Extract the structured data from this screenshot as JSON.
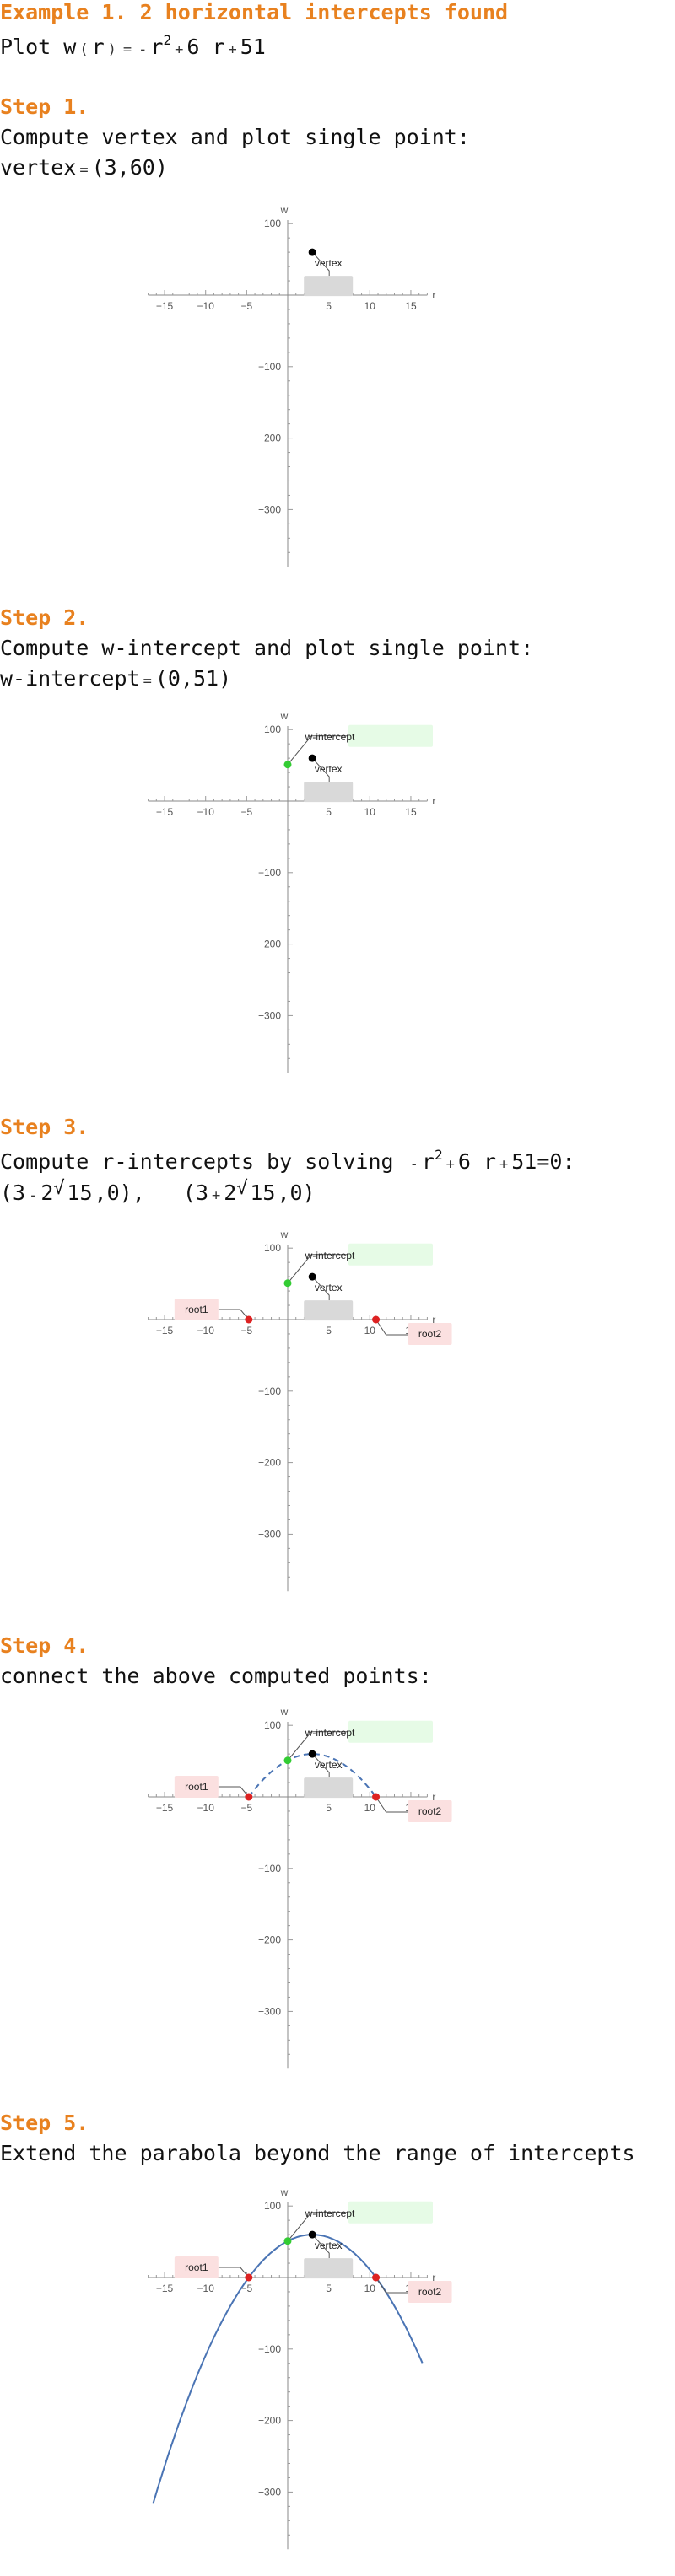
{
  "example": {
    "title": "Example 1. 2 horizontal intercepts found",
    "plot_prefix": "Plot ",
    "func_name": "w",
    "var": "r",
    "rhs_minus": "-",
    "rhs_var": "r",
    "rhs_exp": "2",
    "rhs_plus1": "+",
    "rhs_coef": "6 r",
    "rhs_plus2": "+",
    "rhs_const": "51"
  },
  "steps": [
    {
      "title": "Step 1.",
      "line1": "Compute vertex and plot single point:",
      "line2_label": "vertex",
      "line2_value": "(3,60)"
    },
    {
      "title": "Step 2.",
      "line1": "Compute w-intercept and plot single point:",
      "line2_label": "w-intercept",
      "line2_value": "(0,51)"
    },
    {
      "title": "Step 3.",
      "line1_prefix": "Compute r-intercepts by solving ",
      "eq_minus": "-",
      "eq_var": "r",
      "eq_exp": "2",
      "eq_plus1": "+",
      "eq_coef": "6 r",
      "eq_plus2": "+",
      "eq_tail": "51=0:",
      "root1_open": "(3",
      "root1_minus": "-",
      "root1_coef": "2",
      "root_radicand": "15",
      "root_close": ",0)",
      "root2_open": "(3",
      "root2_plus": "+",
      "root2_coef": "2"
    },
    {
      "title": "Step 4.",
      "line1": "connect the above computed points:"
    },
    {
      "title": "Step 5.",
      "line1": "Extend the parabola beyond the range of intercepts"
    }
  ],
  "chart_data": {
    "type": "scatter",
    "xlabel": "r",
    "ylabel": "w",
    "xlim": [
      -17,
      17
    ],
    "ylim": [
      -380,
      105
    ],
    "x_ticks": [
      -15,
      -10,
      -5,
      5,
      10,
      15
    ],
    "y_ticks": [
      100,
      -100,
      -200,
      -300
    ],
    "function": "w(r) = -r^2 + 6r + 51",
    "points": {
      "vertex": {
        "label": "vertex",
        "x": 3,
        "y": 60,
        "color": "#000000",
        "label_bg": "#d9d9d9"
      },
      "w_intercept": {
        "label": "w-intercept",
        "x": 0,
        "y": 51,
        "color": "#33cc33",
        "label_bg": "#e6fbe6"
      },
      "root1": {
        "label": "root1",
        "x": -4.746,
        "y": 0,
        "color": "#dd2222",
        "label_bg": "#fbe0e0"
      },
      "root2": {
        "label": "root2",
        "x": 10.746,
        "y": 0,
        "color": "#dd2222",
        "label_bg": "#fbe0e0"
      }
    },
    "curve_color": "#4a74b4",
    "panels": [
      {
        "show": [
          "vertex"
        ],
        "curve": "none"
      },
      {
        "show": [
          "vertex",
          "w_intercept"
        ],
        "curve": "none"
      },
      {
        "show": [
          "vertex",
          "w_intercept",
          "root1",
          "root2"
        ],
        "curve": "none"
      },
      {
        "show": [
          "vertex",
          "w_intercept",
          "root1",
          "root2"
        ],
        "curve": "dashed",
        "curve_range": [
          -4.746,
          10.746
        ]
      },
      {
        "show": [
          "vertex",
          "w_intercept",
          "root1",
          "root2"
        ],
        "curve": "solid",
        "curve_range": [
          -16.4,
          16.4
        ]
      }
    ]
  }
}
